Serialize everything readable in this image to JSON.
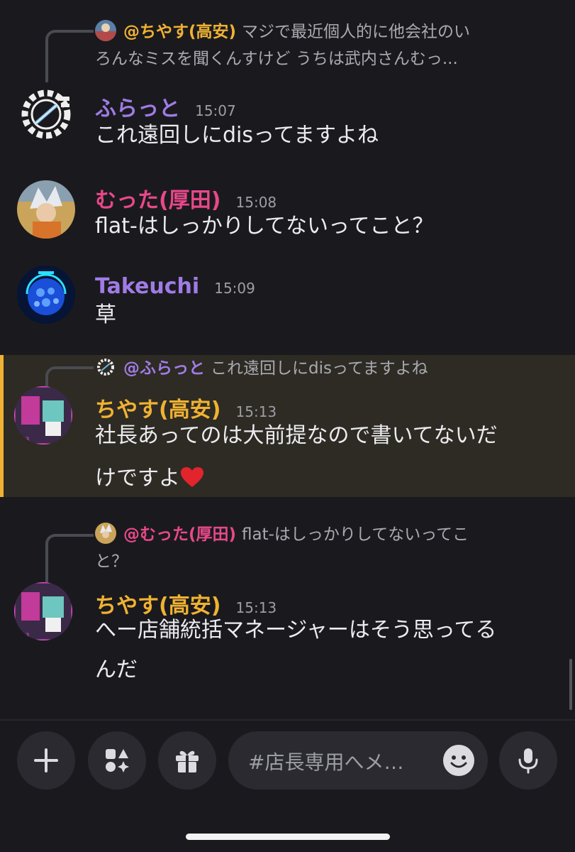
{
  "colors": {
    "purple": "#a07be6",
    "pink": "#e8488a",
    "gold": "#f0b232",
    "muted": "#a9a9b0"
  },
  "messages": [
    {
      "reply": {
        "name": "@ちやす(高安)",
        "line1": "マジで最近個人的に他会社のい",
        "line2": "ろんなミスを聞くんすけど うちは武内さんむっ..."
      },
      "author": "ふらっと",
      "time": "15:07",
      "text": "これ遠回しにdisってますよね"
    },
    {
      "author": "むった(厚田)",
      "time": "15:08",
      "text": "flat-はしっかりしてないってこと？"
    },
    {
      "author": "Takeuchi",
      "time": "15:09",
      "text": "草"
    },
    {
      "reply": {
        "name": "@ふらっと",
        "line1": "これ遠回しにdisってますよね"
      },
      "author": "ちやす(高安)",
      "time": "15:13",
      "text": "社長あってのは大前提なので書いてないだ",
      "text2": "けですよ"
    },
    {
      "reply": {
        "name": "@むった(厚田)",
        "line1": "flat-はしっかりしてないってこ",
        "line2": "と？"
      },
      "author": "ちやす(高安)",
      "time": "15:13",
      "text": "へー店舗統括マネージャーはそう思ってる",
      "text2": "んだ"
    }
  ],
  "composer": {
    "placeholder": "#店長専用へメ…"
  }
}
